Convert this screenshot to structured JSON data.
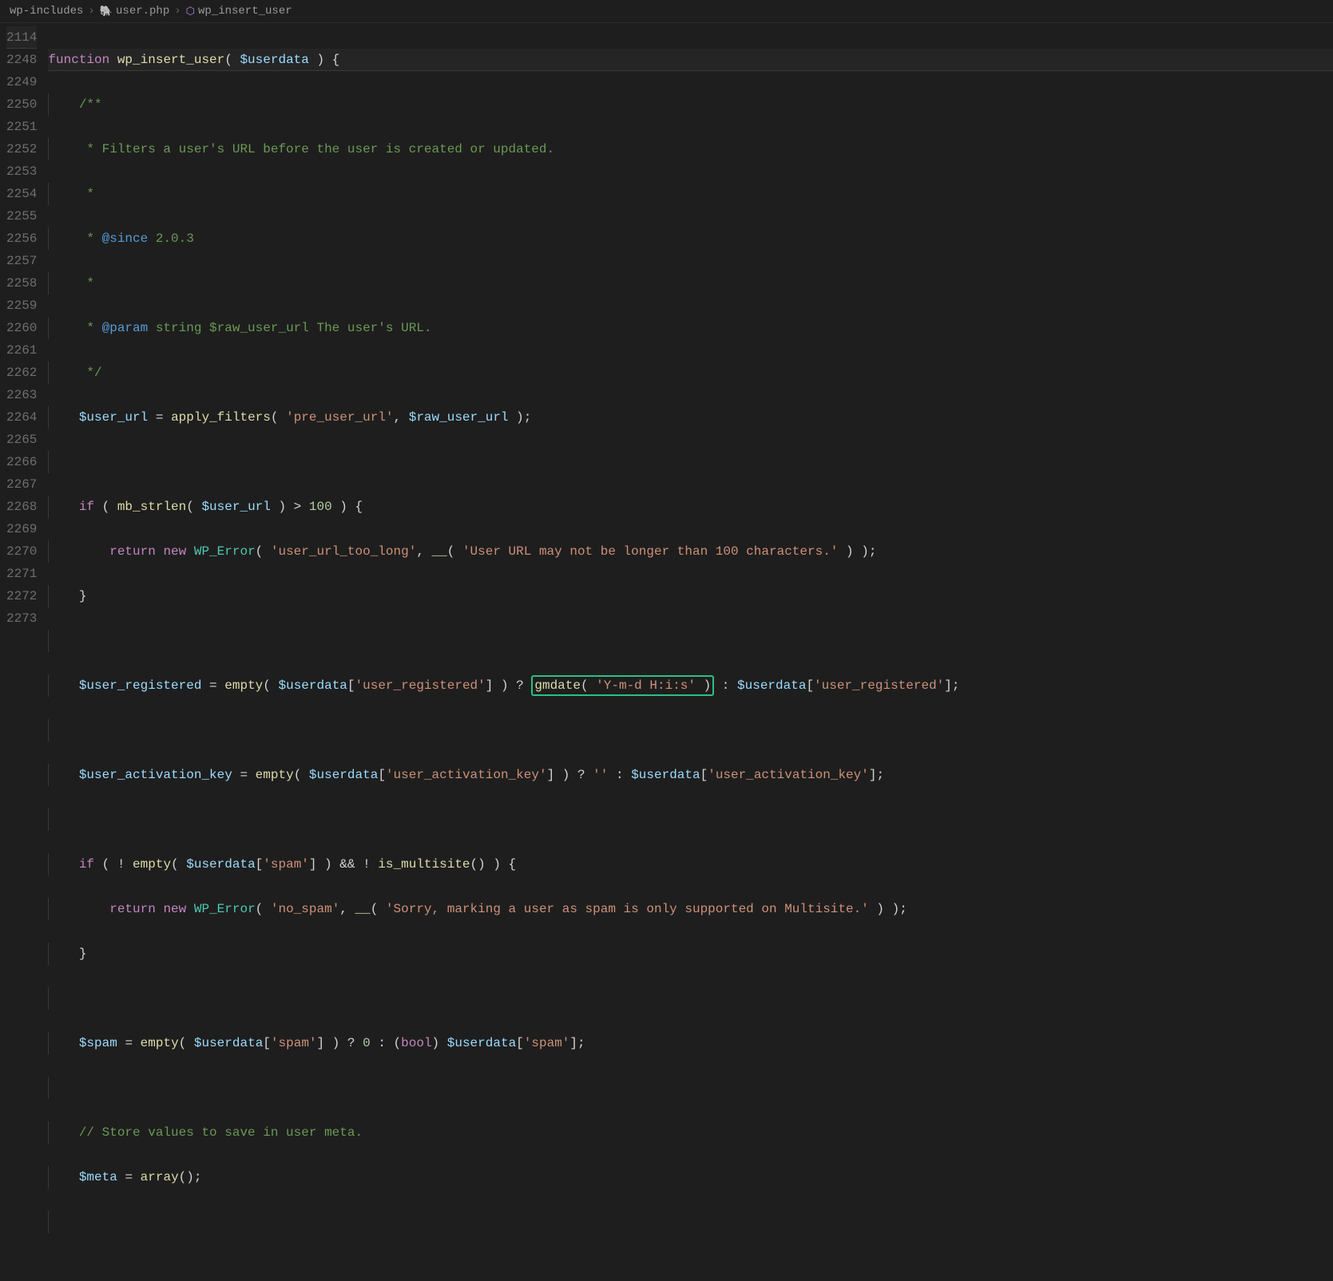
{
  "breadcrumb": {
    "part1": "wp-includes",
    "part2": "user.php",
    "part3": "wp_insert_user"
  },
  "lines": {
    "l0": "2114",
    "l1": "2248",
    "l2": "2249",
    "l3": "2250",
    "l4": "2251",
    "l5": "2252",
    "l6": "2253",
    "l7": "2254",
    "l8": "2255",
    "l9": "2256",
    "l10": "2257",
    "l11": "2258",
    "l12": "2259",
    "l13": "2260",
    "l14": "2261",
    "l15": "2262",
    "l16": "2263",
    "l17": "2264",
    "l18": "2265",
    "l19": "2266",
    "l20": "2267",
    "l21": "2268",
    "l22": "2269",
    "l23": "2270",
    "l24": "2271",
    "l25": "2272",
    "l26": "2273"
  },
  "code": {
    "fn_kw": "function",
    "fn_name": "wp_insert_user",
    "fn_param": "$userdata",
    "doc_open": "/**",
    "doc_star": " *",
    "doc_line1_a": " * Filters a user's URL before the user is created or updated.",
    "doc_since_tag": "@since",
    "doc_since_val": " 2.0.3",
    "doc_param_tag": "@param",
    "doc_param_rest": " string $raw_user_url The user's URL.",
    "doc_close": " */",
    "v_user_url": "$user_url",
    "apply_filters": "apply_filters",
    "s_pre_user_url": "'pre_user_url'",
    "v_raw_user_url": "$raw_user_url",
    "kw_if": "if",
    "mb_strlen": "mb_strlen",
    "n_100": "100",
    "kw_return": "return",
    "kw_new": "new",
    "cls_wp_error": "WP_Error",
    "s_url_too_long": "'user_url_too_long'",
    "fn_gettext": "__",
    "s_url_too_long_msg": "'User URL may not be longer than 100 characters.'",
    "v_user_registered": "$user_registered",
    "empty": "empty",
    "v_userdata": "$userdata",
    "s_user_registered": "'user_registered'",
    "gmdate": "gmdate",
    "s_date_fmt": "'Y-m-d H:i:s'",
    "v_user_activation_key": "$user_activation_key",
    "s_user_activation_key": "'user_activation_key'",
    "s_empty": "''",
    "s_spam": "'spam'",
    "is_multisite": "is_multisite",
    "s_no_spam": "'no_spam'",
    "s_no_spam_msg": "'Sorry, marking a user as spam is only supported on Multisite.'",
    "v_spam": "$spam",
    "n_0": "0",
    "bool_cast": "bool",
    "comment_store": "// Store values to save in user meta.",
    "v_meta": "$meta",
    "array": "array"
  }
}
